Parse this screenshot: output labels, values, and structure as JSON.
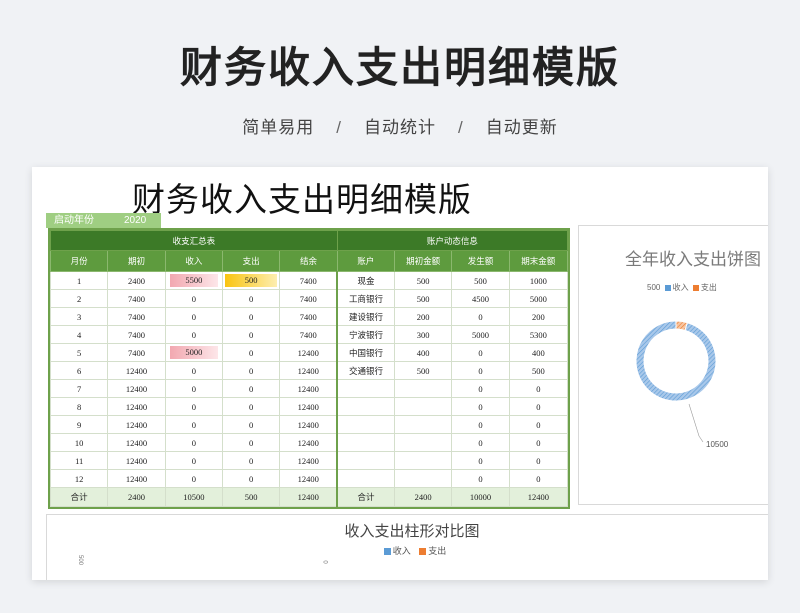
{
  "banner": {
    "title": "财务收入支出明细模版",
    "tags": [
      "简单易用",
      "自动统计",
      "自动更新"
    ],
    "separator": "/"
  },
  "sheet": {
    "title": "财务收入支出明细模版",
    "start_year_label": "启动年份",
    "start_year": "2020"
  },
  "summary": {
    "group_label": "收支汇总表",
    "headers": [
      "月份",
      "期初",
      "收入",
      "支出",
      "结余"
    ],
    "rows": [
      [
        "1",
        "2400",
        "5500",
        "500",
        "7400"
      ],
      [
        "2",
        "7400",
        "0",
        "0",
        "7400"
      ],
      [
        "3",
        "7400",
        "0",
        "0",
        "7400"
      ],
      [
        "4",
        "7400",
        "0",
        "0",
        "7400"
      ],
      [
        "5",
        "7400",
        "5000",
        "0",
        "12400"
      ],
      [
        "6",
        "12400",
        "0",
        "0",
        "12400"
      ],
      [
        "7",
        "12400",
        "0",
        "0",
        "12400"
      ],
      [
        "8",
        "12400",
        "0",
        "0",
        "12400"
      ],
      [
        "9",
        "12400",
        "0",
        "0",
        "12400"
      ],
      [
        "10",
        "12400",
        "0",
        "0",
        "12400"
      ],
      [
        "11",
        "12400",
        "0",
        "0",
        "12400"
      ],
      [
        "12",
        "12400",
        "0",
        "0",
        "12400"
      ]
    ],
    "total": [
      "合计",
      "2400",
      "10500",
      "500",
      "12400"
    ]
  },
  "accounts": {
    "group_label": "账户动态信息",
    "headers": [
      "账户",
      "期初金额",
      "发生额",
      "期末金额"
    ],
    "rows": [
      [
        "现金",
        "500",
        "500",
        "1000"
      ],
      [
        "工商银行",
        "500",
        "4500",
        "5000"
      ],
      [
        "建设银行",
        "200",
        "0",
        "200"
      ],
      [
        "宁波银行",
        "300",
        "5000",
        "5300"
      ],
      [
        "中国银行",
        "400",
        "0",
        "400"
      ],
      [
        "交通银行",
        "500",
        "0",
        "500"
      ],
      [
        "",
        "",
        "0",
        "0"
      ],
      [
        "",
        "",
        "0",
        "0"
      ],
      [
        "",
        "",
        "0",
        "0"
      ],
      [
        "",
        "",
        "0",
        "0"
      ],
      [
        "",
        "",
        "0",
        "0"
      ],
      [
        "",
        "",
        "0",
        "0"
      ]
    ],
    "total": [
      "合计",
      "2400",
      "10000",
      "12400"
    ]
  },
  "pie_chart": {
    "title": "全年收入支出饼图",
    "legend": [
      "收入",
      "支出"
    ],
    "colors": {
      "income": "#5b9bd5",
      "expense": "#ed7d31"
    },
    "labels": {
      "expense": "500",
      "income": "10500"
    }
  },
  "bar_chart": {
    "title": "收入支出柱形对比图",
    "legend": [
      "收入",
      "支出"
    ],
    "ticks": [
      "500",
      "0"
    ]
  },
  "chart_data": [
    {
      "type": "pie",
      "title": "全年收入支出饼图",
      "categories": [
        "收入",
        "支出"
      ],
      "values": [
        10500,
        500
      ]
    },
    {
      "type": "bar",
      "title": "收入支出柱形对比图",
      "series": [
        {
          "name": "收入"
        },
        {
          "name": "支出"
        }
      ]
    }
  ]
}
